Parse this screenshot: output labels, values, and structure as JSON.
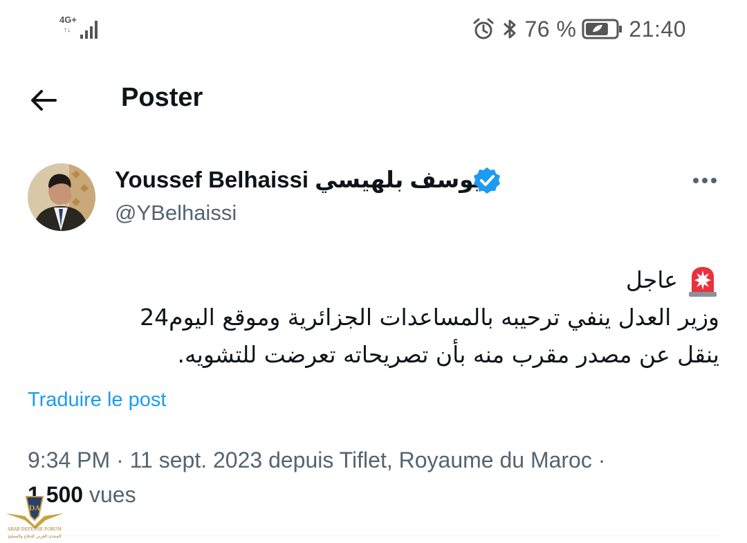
{
  "status_bar": {
    "network": "4G+",
    "network_sub": "↑↓",
    "battery_percent": "76 %",
    "battery_level": 0.76,
    "time": "21:40",
    "icons": [
      "signal-icon",
      "alarm-icon",
      "bluetooth-icon",
      "battery-icon"
    ]
  },
  "header": {
    "title": "Poster",
    "back_icon": "arrow-left-icon"
  },
  "author": {
    "name": "Youssef Belhaissi يوسف بلهيسي",
    "handle": "@YBelhaissi",
    "verified_color": "#1d9bf0"
  },
  "tweet": {
    "line1": "عاجل",
    "line2": "وزير العدل ينفي ترحيبه بالمساعدات الجزائرية وموقع اليوم24",
    "line3": "ينقل عن مصدر مقرب منه بأن تصريحاته تعرضت للتشويه."
  },
  "translate_label": "Traduire le post",
  "meta": {
    "datetime_location": "9:34 PM · 11 sept. 2023 depuis Tiflet, Royaume du Maroc · ",
    "views_count": "1 500",
    "views_label": " vues"
  },
  "watermark": {
    "logo": "DA",
    "text": "ARAB DEFENSE FORUM",
    "subtext": "المنتدى العربي للدفاع والتسليح"
  },
  "colors": {
    "accent": "#1d9bf0",
    "text_primary": "#0f1419",
    "text_secondary": "#536471"
  }
}
